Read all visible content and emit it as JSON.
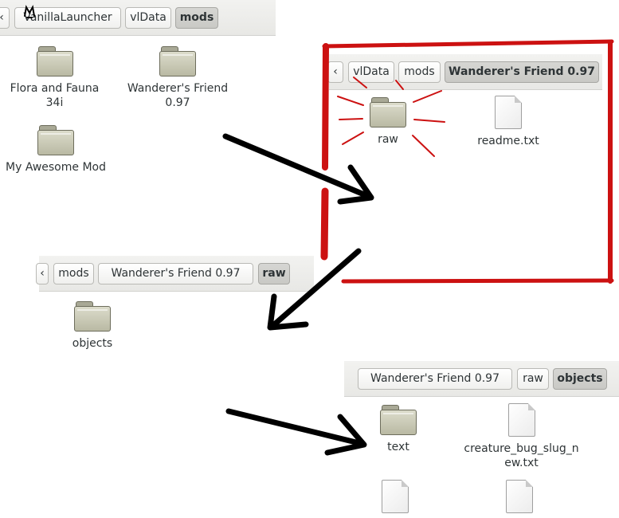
{
  "panel1": {
    "breadcrumbs": [
      "VanillaLauncher",
      "vlData",
      "mods"
    ],
    "items": [
      {
        "kind": "folder",
        "label": "Flora and Fauna 34i"
      },
      {
        "kind": "folder",
        "label": "Wanderer's Friend 0.97"
      },
      {
        "kind": "folder",
        "label": "My Awesome Mod"
      }
    ]
  },
  "panel2": {
    "breadcrumbs": [
      "vlData",
      "mods",
      "Wanderer's Friend 0.97"
    ],
    "items": [
      {
        "kind": "folder",
        "label": "raw"
      },
      {
        "kind": "file",
        "label": "readme.txt"
      }
    ]
  },
  "panel3": {
    "breadcrumbs": [
      "mods",
      "Wanderer's Friend 0.97",
      "raw"
    ],
    "items": [
      {
        "kind": "folder",
        "label": "objects"
      }
    ]
  },
  "panel4": {
    "breadcrumbs": [
      "Wanderer's Friend 0.97",
      "raw",
      "objects"
    ],
    "items": [
      {
        "kind": "folder",
        "label": "text"
      },
      {
        "kind": "file",
        "label": "creature_bug_slug_new.txt"
      },
      {
        "kind": "file",
        "label": ""
      },
      {
        "kind": "file",
        "label": ""
      }
    ]
  },
  "annotation_colors": {
    "highlight": "#cc1111",
    "arrow": "#000000"
  },
  "icons": {
    "folder": "folder-icon",
    "file": "text-file-icon",
    "back": "chevron-left-icon",
    "drawn": "drawn-m-mark"
  }
}
